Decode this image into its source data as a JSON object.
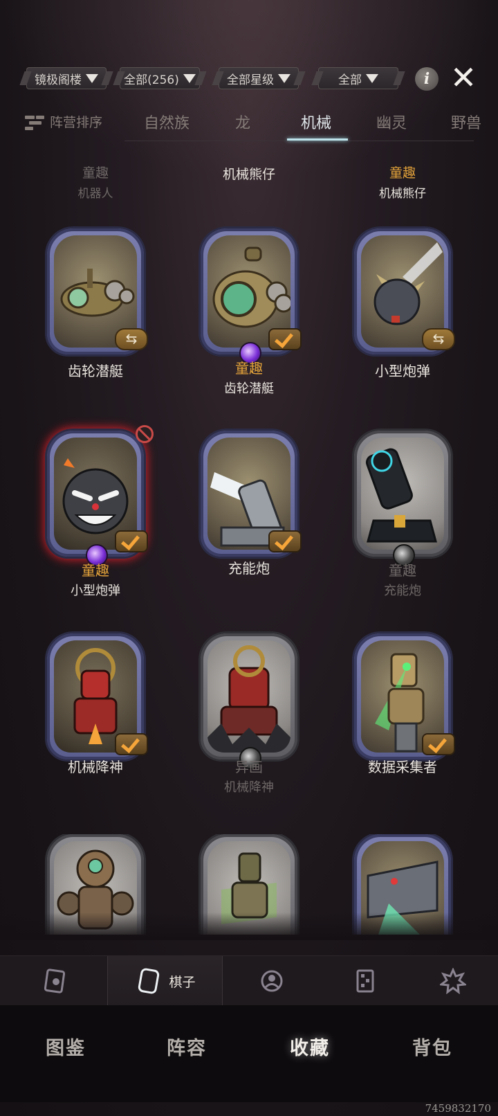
{
  "filters": [
    {
      "label": "镜极阁楼"
    },
    {
      "label": "全部(256)"
    },
    {
      "label": "全部星级"
    },
    {
      "label": "全部"
    }
  ],
  "icons": {
    "info": "info-icon",
    "close": "close-icon"
  },
  "tabs": {
    "sort_label": "阵营排序",
    "items": [
      "自然族",
      "龙",
      "机械",
      "幽灵",
      "野兽"
    ],
    "active": "机械"
  },
  "header_row": [
    {
      "line1": "童趣",
      "line2": "机器人"
    },
    {
      "line1": "机械熊仔",
      "line2": ""
    },
    {
      "line1": "童趣",
      "line2": "机械熊仔"
    }
  ],
  "cards": [
    {
      "line1": "齿轮潜艇",
      "line2": ""
    },
    {
      "line1": "童趣",
      "line2": "齿轮潜艇"
    },
    {
      "line1": "小型炮弹",
      "line2": ""
    },
    {
      "line1": "童趣",
      "line2": "小型炮弹"
    },
    {
      "line1": "充能炮",
      "line2": ""
    },
    {
      "line1": "童趣",
      "line2": "充能炮"
    },
    {
      "line1": "机械降神",
      "line2": ""
    },
    {
      "line1": "异画",
      "line2": "机械降神"
    },
    {
      "line1": "数据采集者",
      "line2": ""
    }
  ],
  "subnav": {
    "active_label": "棋子"
  },
  "bottom_nav": [
    "图鉴",
    "阵容",
    "收藏",
    "背包"
  ],
  "bottom_nav_active": "收藏",
  "footer_id": "7459832170",
  "colors": {
    "gold": "#e2a23a",
    "accent_tab": "#bfe3ea",
    "frame": "#6b6e9f"
  }
}
